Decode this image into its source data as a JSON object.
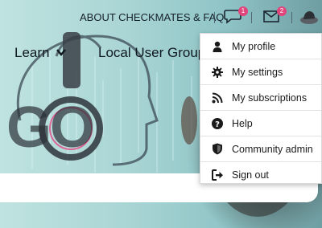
{
  "topnav": {
    "about_label": "ABOUT CHECKMATES & FAQ",
    "messages_badge": "1",
    "mail_badge": "2"
  },
  "mainnav": {
    "learn_label": "Learn",
    "local_label": "Local User Group"
  },
  "hero": {
    "logo_text": "GO"
  },
  "user_menu": {
    "items": [
      {
        "label": "My profile",
        "icon": "user-icon"
      },
      {
        "label": "My settings",
        "icon": "gear-icon"
      },
      {
        "label": "My subscriptions",
        "icon": "rss-icon"
      },
      {
        "label": "Help",
        "icon": "question-icon"
      },
      {
        "label": "Community admin",
        "icon": "shield-icon"
      },
      {
        "label": "Sign out",
        "icon": "sign-out-icon"
      }
    ]
  },
  "colors": {
    "badge": "#e0457b",
    "accent_pink": "#e05a8c"
  }
}
